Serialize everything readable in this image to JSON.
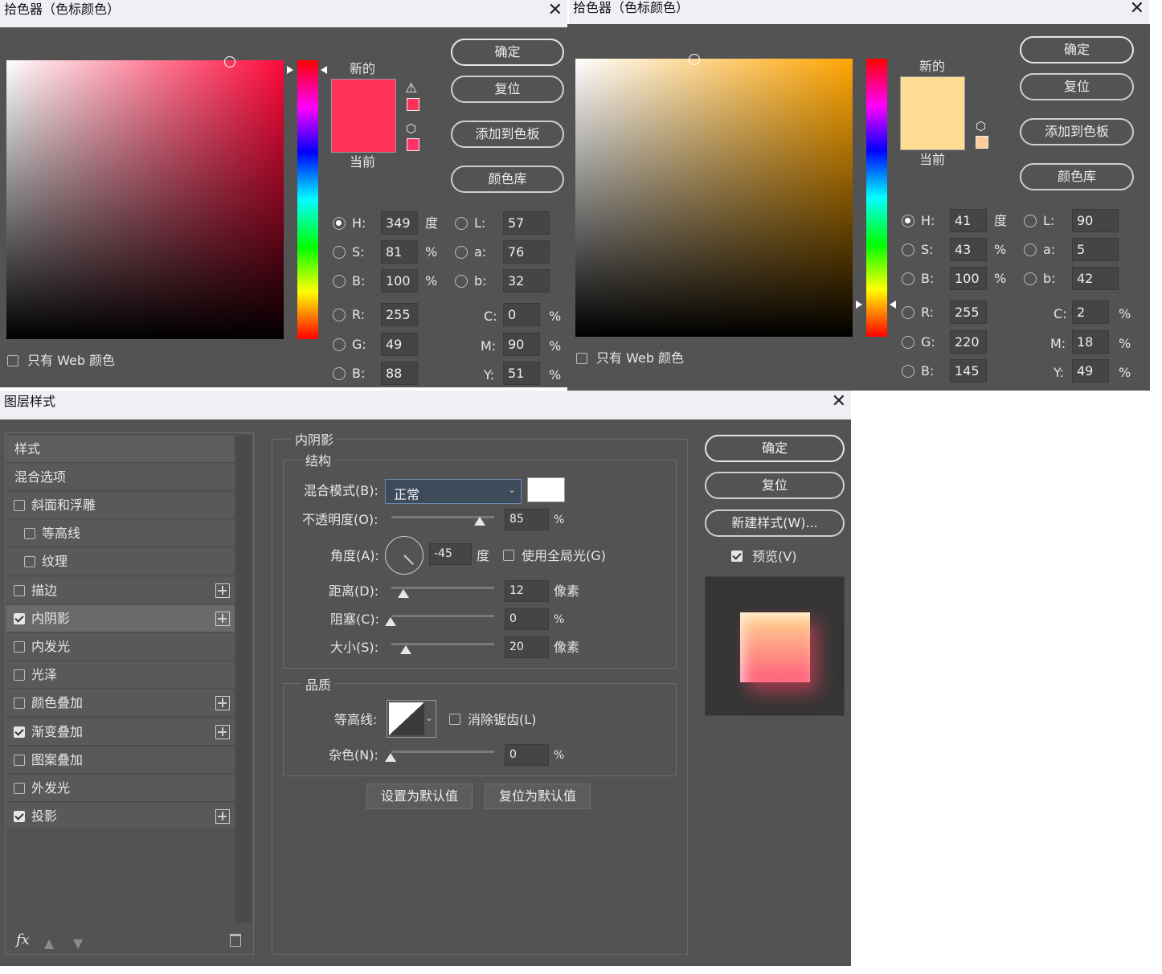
{
  "picker1": {
    "title": "拾色器（色标颜色）",
    "close": "✕",
    "new_label": "新的",
    "current_label": "当前",
    "new_color": "#fe3158",
    "current_color": "#fe3158",
    "buttons": {
      "ok": "确定",
      "reset": "复位",
      "add_swatch": "添加到色板",
      "library": "颜色库"
    },
    "web_only": "只有 Web 颜色",
    "fields": {
      "H": {
        "label": "H:",
        "value": "349",
        "unit": "度"
      },
      "S": {
        "label": "S:",
        "value": "81",
        "unit": "%"
      },
      "Bv": {
        "label": "B:",
        "value": "100",
        "unit": "%"
      },
      "R": {
        "label": "R:",
        "value": "255"
      },
      "G": {
        "label": "G:",
        "value": "49"
      },
      "Bc": {
        "label": "B:",
        "value": "88"
      },
      "L": {
        "label": "L:",
        "value": "57"
      },
      "a": {
        "label": "a:",
        "value": "76"
      },
      "b": {
        "label": "b:",
        "value": "32"
      },
      "C": {
        "label": "C:",
        "value": "0",
        "unit": "%"
      },
      "M": {
        "label": "M:",
        "value": "90",
        "unit": "%"
      },
      "Y": {
        "label": "Y:",
        "value": "51",
        "unit": "%"
      }
    }
  },
  "picker2": {
    "title": "拾色器（色标颜色）",
    "close": "✕",
    "new_label": "新的",
    "current_label": "当前",
    "new_color": "#ffdc91",
    "current_color": "#ffd08f",
    "buttons": {
      "ok": "确定",
      "reset": "复位",
      "add_swatch": "添加到色板",
      "library": "颜色库"
    },
    "web_only": "只有 Web 颜色",
    "fields": {
      "H": {
        "label": "H:",
        "value": "41",
        "unit": "度"
      },
      "S": {
        "label": "S:",
        "value": "43",
        "unit": "%"
      },
      "Bv": {
        "label": "B:",
        "value": "100",
        "unit": "%"
      },
      "R": {
        "label": "R:",
        "value": "255"
      },
      "G": {
        "label": "G:",
        "value": "220"
      },
      "Bc": {
        "label": "B:",
        "value": "145"
      },
      "L": {
        "label": "L:",
        "value": "90"
      },
      "a": {
        "label": "a:",
        "value": "5"
      },
      "b": {
        "label": "b:",
        "value": "42"
      },
      "C": {
        "label": "C:",
        "value": "2",
        "unit": "%"
      },
      "M": {
        "label": "M:",
        "value": "18",
        "unit": "%"
      },
      "Y": {
        "label": "Y:",
        "value": "49",
        "unit": "%"
      }
    }
  },
  "layer_style": {
    "title": "图层样式",
    "close": "✕",
    "styles_header": "样式",
    "blend_options": "混合选项",
    "items": [
      {
        "label": "斜面和浮雕",
        "checked": false,
        "plus": false
      },
      {
        "label": "等高线",
        "checked": false,
        "plus": false
      },
      {
        "label": "纹理",
        "checked": false,
        "plus": false
      },
      {
        "label": "描边",
        "checked": false,
        "plus": true
      },
      {
        "label": "内阴影",
        "checked": true,
        "plus": true
      },
      {
        "label": "内发光",
        "checked": false,
        "plus": false
      },
      {
        "label": "光泽",
        "checked": false,
        "plus": false
      },
      {
        "label": "颜色叠加",
        "checked": false,
        "plus": true
      },
      {
        "label": "渐变叠加",
        "checked": true,
        "plus": true
      },
      {
        "label": "图案叠加",
        "checked": false,
        "plus": false
      },
      {
        "label": "外发光",
        "checked": false,
        "plus": false
      },
      {
        "label": "投影",
        "checked": true,
        "plus": true
      }
    ],
    "fx": "fx",
    "panel_title": "内阴影",
    "structure_title": "结构",
    "blend_mode_label": "混合模式(B):",
    "blend_mode_value": "正常",
    "opacity_label": "不透明度(O):",
    "opacity_value": "85",
    "opacity_unit": "%",
    "opacity_level": 0.85,
    "angle_label": "角度(A):",
    "angle_value": "-45",
    "angle_unit": "度",
    "global_light": "使用全局光(G)",
    "distance_label": "距离(D):",
    "distance_value": "12",
    "distance_unit": "像素",
    "choke_label": "阻塞(C):",
    "choke_value": "0",
    "choke_unit": "%",
    "size_label": "大小(S):",
    "size_value": "20",
    "size_unit": "像素",
    "quality_title": "品质",
    "contour_label": "等高线:",
    "antialias": "消除锯齿(L)",
    "noise_label": "杂色(N):",
    "noise_value": "0",
    "noise_unit": "%",
    "set_default": "设置为默认值",
    "reset_default": "复位为默认值",
    "ok": "确定",
    "reset": "复位",
    "new_style": "新建样式(W)...",
    "preview": "预览(V)"
  }
}
